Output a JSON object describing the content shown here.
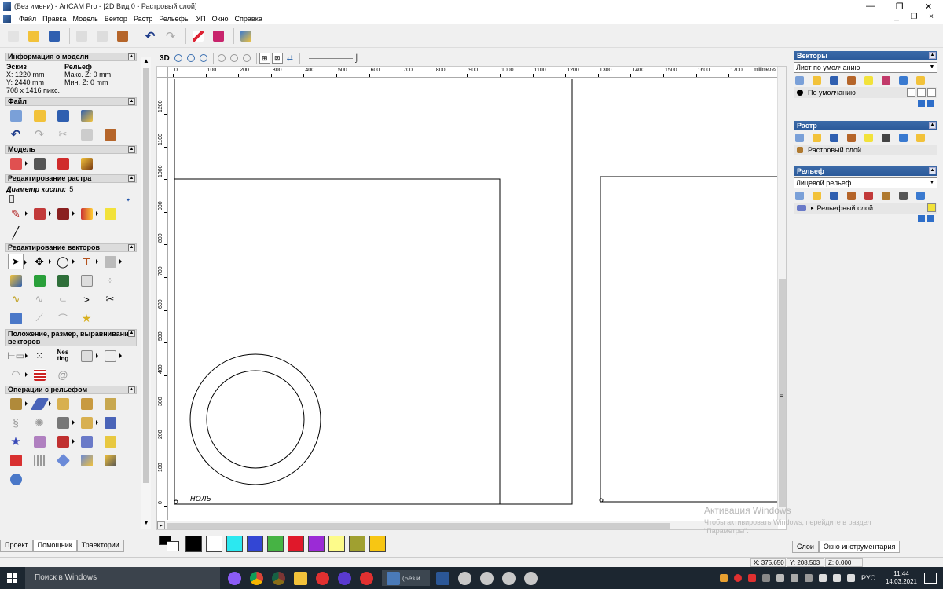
{
  "window": {
    "title": "(Без имени) - ArtCAM Pro - [2D Вид:0 - Растровый слой]",
    "controls": {
      "minimize": "—",
      "maximize": "❐",
      "close": "✕"
    }
  },
  "menu": {
    "items": [
      "Файл",
      "Правка",
      "Модель",
      "Вектор",
      "Растр",
      "Рельефы",
      "УП",
      "Окно",
      "Справка"
    ],
    "mdi_controls": {
      "minimize": "_",
      "restore": "❐",
      "close": "×"
    }
  },
  "toolbar": {
    "buttons": [
      "new-icon",
      "open-icon",
      "save-icon",
      "cut-icon",
      "copy-icon",
      "paste-icon",
      "undo-icon",
      "redo-icon",
      "edit-icon",
      "book-icon",
      "wizard-icon"
    ]
  },
  "left_panel": {
    "model_info": {
      "header": "Информация о модели",
      "sketch_label": "Эскиз",
      "relief_label": "Рельеф",
      "x": "X: 1220 mm",
      "max_z": "Макс. Z: 0 mm",
      "y": "Y: 2440 mm",
      "min_z": "Мин. Z: 0 mm",
      "pixels": "708 x 1416 пикс."
    },
    "file_header": "Файл",
    "model_header": "Модель",
    "raster_edit_header": "Редактирование растра",
    "brush_label": "Диаметр кисти:",
    "brush_value": "5",
    "vector_edit_header": "Редактирование векторов",
    "vector_position_header": "Положение, размер, выравнивание векторов",
    "relief_ops_header": "Операции с рельефом",
    "nesting_label": "Nes ting",
    "tabs": [
      "Проект",
      "Помощник",
      "Траектории"
    ],
    "active_tab": "Помощник"
  },
  "view_toolbar": {
    "mode_3d": "3D"
  },
  "ruler": {
    "units": "millimetres",
    "h_labels": [
      "0",
      "100",
      "200",
      "300",
      "400",
      "500",
      "600",
      "700",
      "800",
      "900",
      "1000",
      "1100",
      "1200",
      "1300",
      "1400",
      "1500",
      "1600",
      "1700"
    ],
    "v_labels": [
      "1200",
      "1100",
      "1000",
      "900",
      "800",
      "700",
      "600",
      "500",
      "400",
      "300",
      "200",
      "100",
      "0"
    ]
  },
  "canvas": {
    "handwriting": "НОЛЬ"
  },
  "palette": {
    "colors": [
      "#000000",
      "#ffffff",
      "#2be8f0",
      "#3346d4",
      "#46b344",
      "#e0182a",
      "#9b2bd6",
      "#fdfb8a",
      "#a0a030",
      "#f7c613"
    ]
  },
  "right_panel": {
    "vectors": {
      "header": "Векторы",
      "combo": "Лист по умолчанию",
      "layer": "По умолчанию"
    },
    "raster": {
      "header": "Растр",
      "layer": "Растровый слой"
    },
    "relief": {
      "header": "Рельеф",
      "combo": "Лицевой рельеф",
      "layer": "Рельефный слой"
    },
    "tabs": [
      "Слои",
      "Окно инструментария"
    ],
    "active_tab": "Окно инструментария"
  },
  "status": {
    "x": "X: 375.650",
    "y": "Y: 208.503",
    "z": "Z: 0.000"
  },
  "watermark": {
    "title": "Активация Windows",
    "line1": "Чтобы активировать Windows, перейдите в раздел",
    "line2": "\"Параметры\"."
  },
  "taskbar": {
    "search_placeholder": "Поиск в Windows",
    "active_app_label": "(Без и...",
    "language": "РУС",
    "time": "11:44",
    "date": "14.03.2021"
  }
}
